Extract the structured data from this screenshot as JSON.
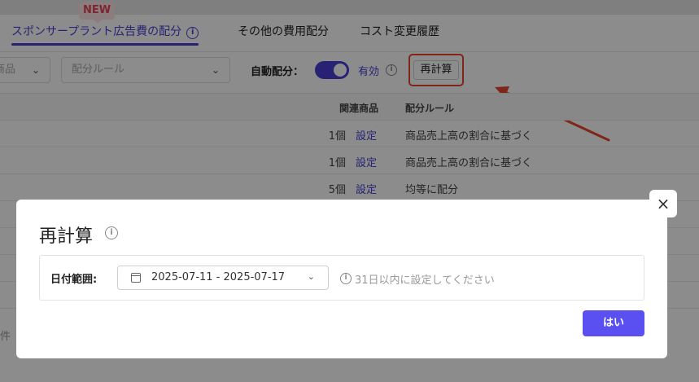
{
  "tabs": {
    "badge": "NEW",
    "items": [
      {
        "label": "スポンサープラント広告費の配分",
        "info": "i"
      },
      {
        "label": "その他の費用配分"
      },
      {
        "label": "コスト変更履歴"
      }
    ]
  },
  "filters": {
    "product_select": "商品",
    "rule_select_placeholder": "配分ルール",
    "auto_allocation_label": "自動配分：",
    "auto_allocation_state": "有効",
    "recalc_button": "再計算"
  },
  "table": {
    "headers": {
      "related_products": "関連商品",
      "allocation_rule": "配分ルール"
    },
    "rows": [
      {
        "count": "1個",
        "action": "設定",
        "rule": "商品売上高の割合に基づく"
      },
      {
        "count": "1個",
        "action": "設定",
        "rule": "商品売上高の割合に基づく"
      },
      {
        "count": "5個",
        "action": "設定",
        "rule": "均等に配分"
      }
    ],
    "footer_text": "件"
  },
  "modal": {
    "title": "再計算",
    "date_label": "日付範囲:",
    "date_range": "2025-07-11 - 2025-07-17",
    "hint": "31日以内に設定してください",
    "ok_button": "はい",
    "close": "×"
  },
  "colors": {
    "accent": "#4a3fd6",
    "primary_button": "#5a4ff0",
    "highlight": "#e5482c",
    "badge": "#e0455a"
  }
}
